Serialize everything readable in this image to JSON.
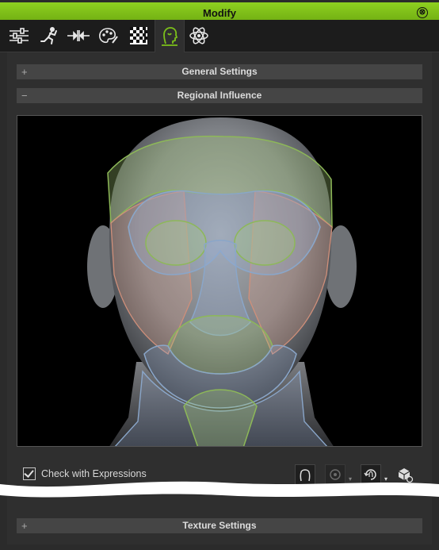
{
  "window": {
    "title": "Modify",
    "close_symbol": "⊗"
  },
  "tabs": [
    {
      "name": "sliders"
    },
    {
      "name": "motion"
    },
    {
      "name": "align"
    },
    {
      "name": "palette"
    },
    {
      "name": "checker"
    },
    {
      "name": "head",
      "active": true
    },
    {
      "name": "atom"
    }
  ],
  "sections": {
    "general": {
      "sign": "+",
      "label": "General Settings"
    },
    "regional": {
      "sign": "−",
      "label": "Regional Influence"
    },
    "texture": {
      "sign": "+",
      "label": "Texture Settings"
    }
  },
  "options": {
    "check_expressions_label": "Check with Expressions",
    "check_expressions_checked": true
  },
  "colors": {
    "accent": "#7cc01a",
    "panel": "#2f2f2f",
    "header": "#454545"
  }
}
